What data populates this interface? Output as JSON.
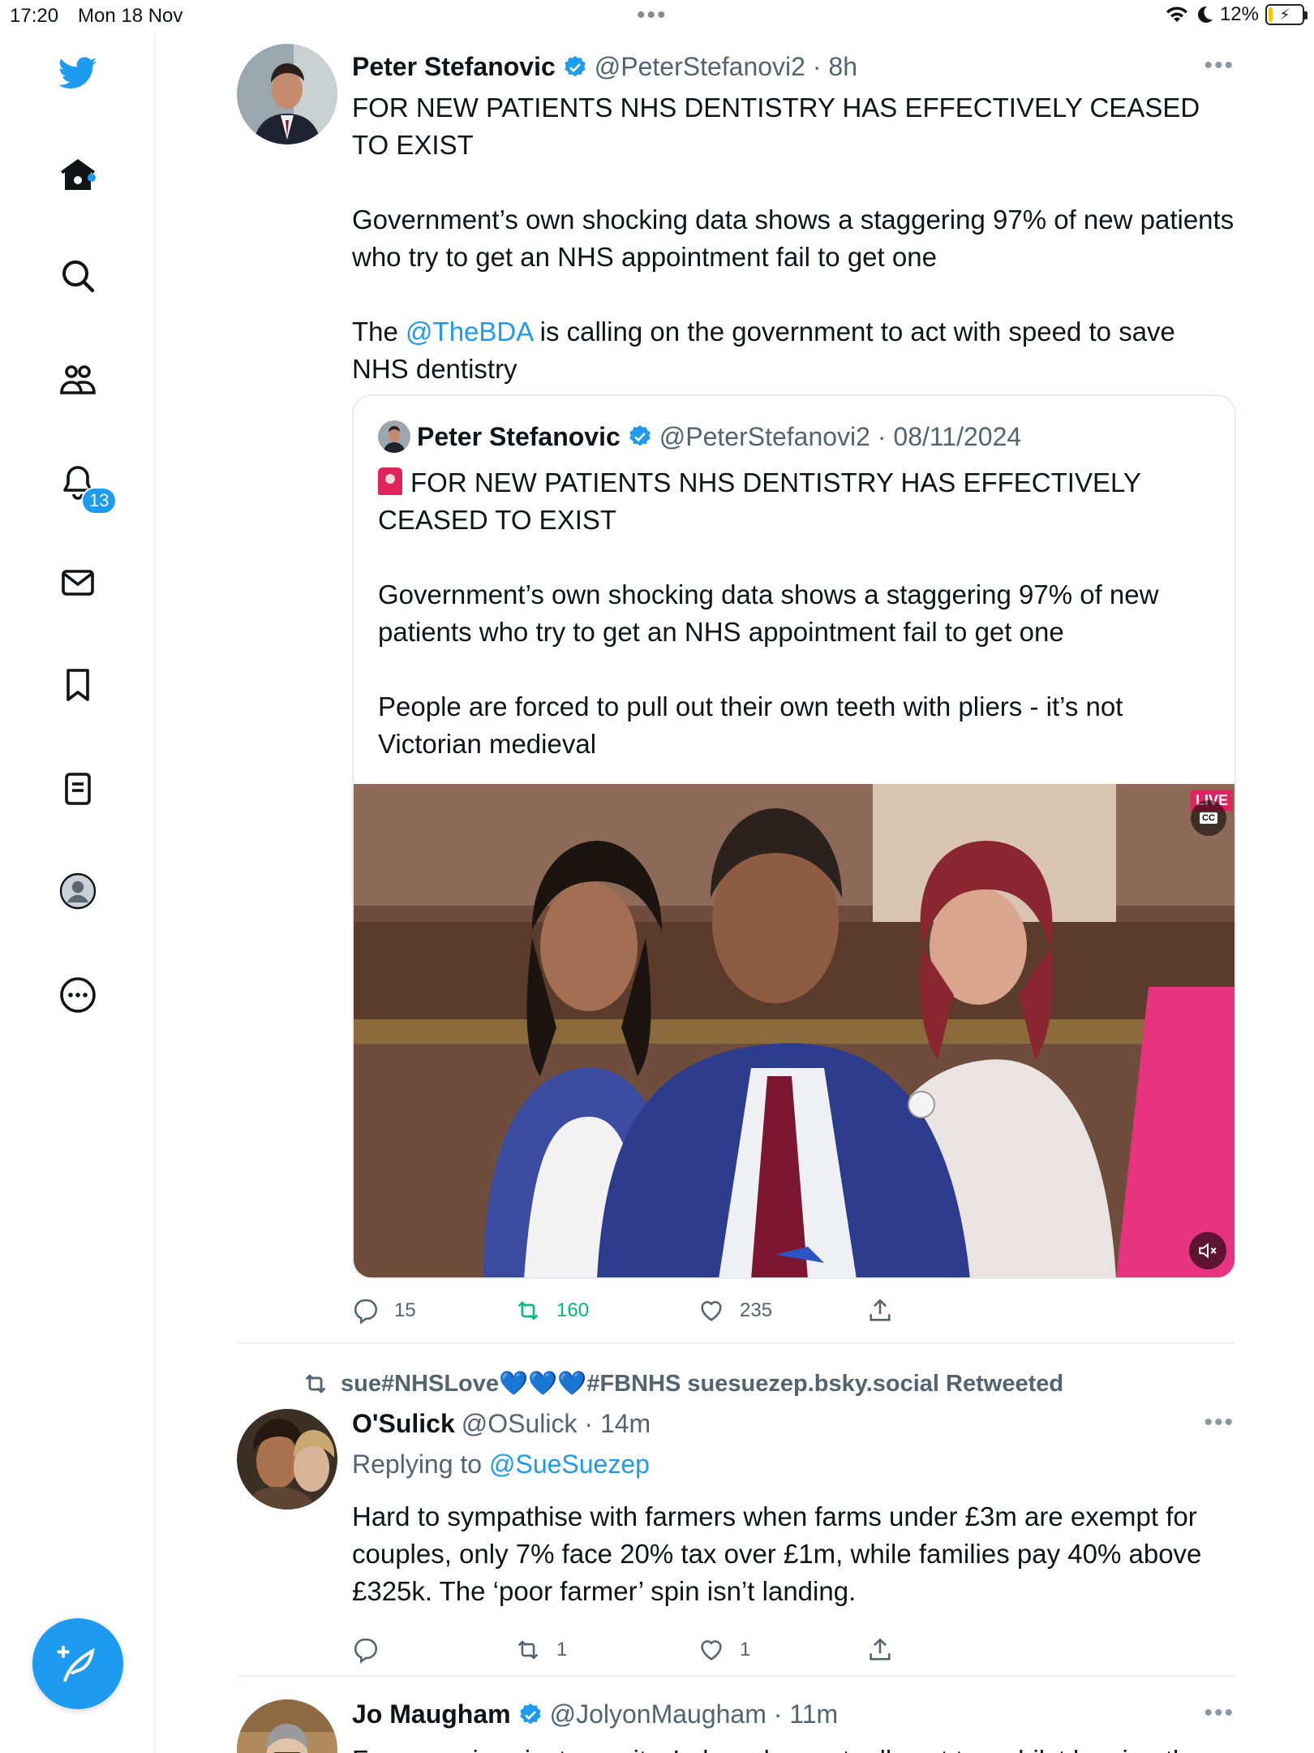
{
  "status_bar": {
    "time": "17:20",
    "date": "Mon 18 Nov",
    "battery": "12%",
    "battery_level": 0.12
  },
  "nav": {
    "notifications_badge": "13"
  },
  "tweets": [
    {
      "name": "Peter Stefanovic",
      "handle": "@PeterStefanovi2 · 8h",
      "text_1": "FOR NEW PATIENTS NHS DENTISTRY HAS EFFECTIVELY CEASED TO EXIST\n\nGovernment’s own shocking data shows a staggering 97% of new patients who try to get an NHS appointment fail to get one\n\nThe ",
      "mention": "@TheBDA",
      "text_2": " is calling on the government to act with speed to save NHS dentistry",
      "quote": {
        "name": "Peter Stefanovic",
        "handle": "@PeterStefanovi2 · 08/11/2024",
        "text": "FOR NEW PATIENTS NHS DENTISTRY HAS EFFECTIVELY CEASED TO EXIST\n\nGovernment’s own shocking data shows a staggering 97% of new patients who try to get an NHS appointment fail to get one\n\nPeople are forced to pull out their own teeth with pliers - it’s not Victorian medieval",
        "video_live_label": "LIVE",
        "video_cc_label": "CC"
      },
      "replies": "15",
      "retweets": "160",
      "likes": "235"
    },
    {
      "retweeted_by_prefix": "sue#NHSLove",
      "retweeted_by_suffix": "#FBNHS suesuezep.bsky.social Retweeted",
      "hearts": "💙💙💙",
      "name": "O'Sulick",
      "handle": "@OSulick · 14m",
      "replying_prefix": "Replying to ",
      "replying_to": "@SueSuezep",
      "text": "Hard to sympathise with farmers when farms under £3m are exempt for couples, only 7% face 20% tax over £1m, while families pay 40% above £325k. The ‘poor farmer’ spin isn’t landing.",
      "replies": "",
      "retweets": "1",
      "likes": "1"
    },
    {
      "name": "Jo Maugham",
      "handle": "@JolyonMaugham · 11m",
      "text": "For some in private equity, Labour has actually cut tax whilst leaving the"
    }
  ],
  "colors": {
    "accent": "#1d9bf0",
    "retweet_green": "#00ba7c",
    "secondary_text": "#536471"
  }
}
